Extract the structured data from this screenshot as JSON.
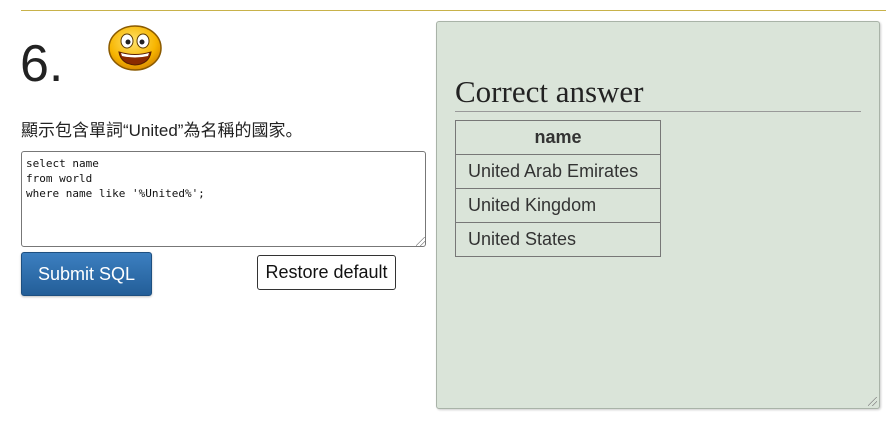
{
  "question": {
    "number": "6.",
    "text": "顯示包含單詞“United”為名稱的國家。"
  },
  "editor": {
    "sql_lines": [
      "select name",
      "from world",
      "where name like '%United%';"
    ]
  },
  "buttons": {
    "submit_label": "Submit SQL",
    "restore_label": "Restore default"
  },
  "answer": {
    "title": "Correct answer",
    "columns": [
      "name"
    ],
    "rows": [
      "United Arab Emirates",
      "United Kingdom",
      "United States"
    ]
  },
  "colors": {
    "panel_bg": "#dae4d9",
    "submit_bg": "#2e6da8",
    "rule": "#c8b24a"
  },
  "icons": {
    "smiley": "grinning-face-icon"
  }
}
